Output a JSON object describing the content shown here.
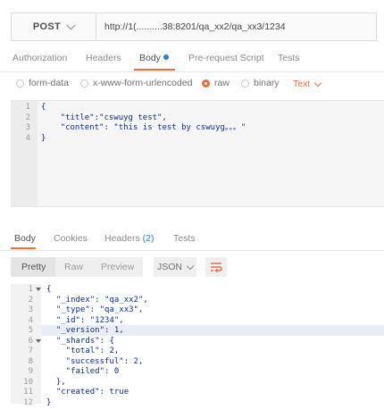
{
  "request": {
    "method": "POST",
    "url": "http://1(..........38:8201/qa_xx2/qa_xx3/1234"
  },
  "request_tabs": [
    "Authorization",
    "Headers",
    "Body",
    "Pre-request Script",
    "Tests"
  ],
  "body_types": {
    "options": [
      "form-data",
      "x-www-form-urlencoded",
      "raw",
      "binary"
    ],
    "selected": "raw",
    "format": "Text"
  },
  "request_body": {
    "line_numbers": [
      "1",
      "2",
      "3",
      "4"
    ],
    "lines": [
      "{",
      "    \"title\":\"cswuyg test\",",
      "    \"content\": \"this is test by cswuyg。。。\"",
      "}"
    ]
  },
  "response_tabs": {
    "body": "Body",
    "cookies": "Cookies",
    "headers": "Headers",
    "headers_count": "(2)",
    "tests": "Tests"
  },
  "response_toolbar": {
    "views": [
      "Pretty",
      "Raw",
      "Preview"
    ],
    "active_view": "Pretty",
    "format": "JSON"
  },
  "response_body": {
    "line_numbers": [
      "1",
      "2",
      "3",
      "4",
      "5",
      "6",
      "7",
      "8",
      "9",
      "10",
      "11",
      "12"
    ],
    "lines": [
      "{",
      "  \"_index\": \"qa_xx2\",",
      "  \"_type\": \"qa_xx3\",",
      "  \"_id\": \"1234\",",
      "  \"_version\": 1,",
      "  \"_shards\": {",
      "    \"total\": 2,",
      "    \"successful\": 2,",
      "    \"failed\": 0",
      "  },",
      "  \"created\": true",
      "}"
    ],
    "highlighted_line": "5"
  },
  "colors": {
    "accent": "#f26b3a",
    "blue": "#1f84d6",
    "code": "#0d2b89"
  }
}
